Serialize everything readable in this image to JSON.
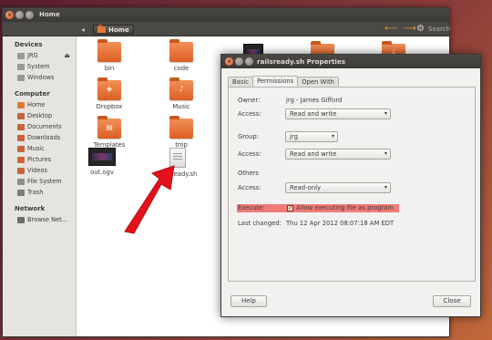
{
  "window": {
    "title": "Home",
    "search": "Search",
    "breadcrumb": "Home"
  },
  "sidebar": [
    {
      "heading": "Devices",
      "items": [
        {
          "label": "JRG",
          "icon": "drive-icon",
          "eject": true
        },
        {
          "label": "System",
          "icon": "drive-icon"
        },
        {
          "label": "Windows",
          "icon": "drive-icon"
        }
      ]
    },
    {
      "heading": "Computer",
      "items": [
        {
          "label": "Home",
          "icon": "home-folder-icon"
        },
        {
          "label": "Desktop",
          "icon": "desktop-icon"
        },
        {
          "label": "Documents",
          "icon": "documents-icon"
        },
        {
          "label": "Downloads",
          "icon": "downloads-icon"
        },
        {
          "label": "Music",
          "icon": "music-icon"
        },
        {
          "label": "Pictures",
          "icon": "pictures-icon"
        },
        {
          "label": "Videos",
          "icon": "videos-icon"
        },
        {
          "label": "File System",
          "icon": "filesystem-icon"
        },
        {
          "label": "Trash",
          "icon": "trash-icon"
        }
      ]
    },
    {
      "heading": "Network",
      "items": [
        {
          "label": "Browse Net...",
          "icon": "network-icon"
        }
      ]
    }
  ],
  "files": [
    {
      "name": "bin",
      "kind": "folder"
    },
    {
      "name": "code",
      "kind": "folder"
    },
    {
      "name": "Dropbox",
      "kind": "folder"
    },
    {
      "name": "Music",
      "kind": "folder"
    },
    {
      "name": "Templates",
      "kind": "folder"
    },
    {
      "name": "tmp",
      "kind": "folder"
    },
    {
      "name": "out.ogv",
      "kind": "video"
    },
    {
      "name": "railsready.sh",
      "kind": "script"
    }
  ],
  "dialog": {
    "title": "railsready.sh Properties",
    "tabs": [
      "Basic",
      "Permissions",
      "Open With"
    ],
    "active_tab": "Permissions",
    "owner_label": "Owner:",
    "owner_value": "jrg - James Gifford",
    "owner_access_label": "Access:",
    "owner_access": "Read and write",
    "group_label": "Group:",
    "group_value": "jrg",
    "group_access_label": "Access:",
    "group_access": "Read and write",
    "others_label": "Others",
    "others_access_label": "Access:",
    "others_access": "Read-only",
    "execute_label": "Execute:",
    "execute_text": "Allow executing file as program",
    "execute_checked": true,
    "changed_label": "Last changed:",
    "changed_value": "Thu 12 Apr 2012 08:07:18 AM EDT",
    "help_button": "Help",
    "close_button": "Close"
  },
  "colors": {
    "accent_orange": "#e0783a",
    "highlight": "#f07a78",
    "arrow": "#e3121a",
    "titlebar": "#3c3b37"
  }
}
